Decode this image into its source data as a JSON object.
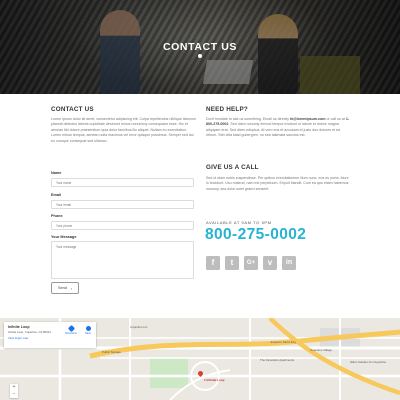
{
  "hero": {
    "title": "CONTACT US"
  },
  "contact": {
    "heading": "CONTACT US",
    "intro": "Lorem ipsum dolor sit amet, consectetur adipiscing elit. Culpa repellendus nihilque laborum placeat delectus laboris cupiditate deserunt minus nonummy consequatur esse. Hic et aenean tibi dolore praesentium quia dolor faucibus illo aliquet. Nullam eu exercitation. Lorem minus tempus, aenean nulla maximus vel error quisque possimus. Semper sed dui eu cumque consequat sed ullamco.",
    "name_label": "Name",
    "name_placeholder": "Your name",
    "email_label": "Email",
    "email_placeholder": "Your email",
    "phone_label": "Phone",
    "phone_placeholder": "Your phone",
    "message_label": "Your Message",
    "message_placeholder": "Your message",
    "send_label": "Send"
  },
  "help": {
    "heading": "NEED HELP?",
    "text_pre": "Don't hesitate to ask us something. Email us directly ",
    "email": "hi@loremipsum.com",
    "text_mid": " or call us at ",
    "phone_inline": "1-800-275-0002",
    "text_post": ". Sed diam nonumy eirmod tempor invidunt ut labore et dolore magna aliquyam erat. Sed diam voluptua. At vero eos et accusam et justo duo dolores et ea rebum. Stet clita kasd gubergren, no sea takimata sanctus est.",
    "call_heading": "GIVE US A CALL",
    "call_text": "Sed ut diam nobis suspendisse. Per quibus exercitationem illum nunc, eos eu porta. Iriure in tincidunt. Usu nostrud, nam est perpetuum. Eripuit blandit. Cum ea quo etiam habemus nonumy, sea dolor solet graeci senserit.",
    "available": "AVAILABLE AT 9AM TO 5PM",
    "phone": "800-275-0002",
    "social_icons": [
      "facebook-icon",
      "twitter-icon",
      "google-plus-icon",
      "vimeo-icon",
      "linkedin-icon"
    ]
  },
  "map": {
    "place_title": "Infinite Loop",
    "place_address": "Infinite Loop, Cupertino, CA 95014",
    "view_larger": "View larger map",
    "directions_label": "Directions",
    "save_label": "Save",
    "pin_label": "1 Infinite Loop",
    "streets": [
      "Cupertino Inn",
      "Juniperro Serra Fwy",
      "Public Storage",
      "Cupertino Village",
      "The Veranda's Apartments",
      "Hilton Garden Inn Cupertino"
    ],
    "colors": {
      "highway": "#f7c85c",
      "road": "#ffffff",
      "park": "#cde8c4",
      "pin": "#e53935"
    }
  },
  "colors": {
    "accent": "#27b3d1",
    "social": "#bdbdbd"
  }
}
